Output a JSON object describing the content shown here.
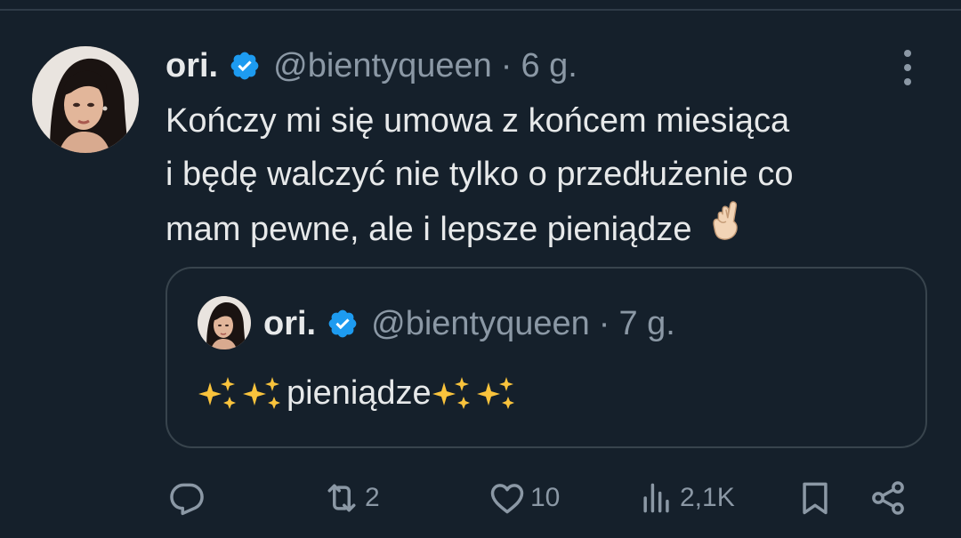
{
  "tweet": {
    "author": {
      "display_name": "ori.",
      "handle": "@bientyqueen",
      "verified": true
    },
    "separator": "·",
    "time": "6 g.",
    "text_lines": [
      "Kończy mi się umowa z końcem miesiąca",
      "i będę walczyć nie tylko o przedłużenie co",
      "mam pewne, ale i lepsze pieniądze"
    ],
    "text_emoji": "crossed-fingers-icon"
  },
  "quote": {
    "author": {
      "display_name": "ori.",
      "handle": "@bientyqueen",
      "verified": true
    },
    "separator": "·",
    "time": "7 g.",
    "text": "pieniądze",
    "emoji": "sparkles-icon"
  },
  "actions": {
    "reply": {
      "icon": "reply-icon",
      "count": ""
    },
    "retweet": {
      "icon": "retweet-icon",
      "count": "2"
    },
    "like": {
      "icon": "heart-icon",
      "count": "10"
    },
    "views": {
      "icon": "views-icon",
      "count": "2,1K"
    },
    "bookmark": {
      "icon": "bookmark-icon",
      "count": ""
    },
    "share": {
      "icon": "share-icon",
      "count": ""
    }
  },
  "colors": {
    "background": "#15202b",
    "text": "#e7e9ea",
    "secondary": "#8b98a5",
    "verified": "#1d9bf0",
    "border": "#38444d"
  }
}
